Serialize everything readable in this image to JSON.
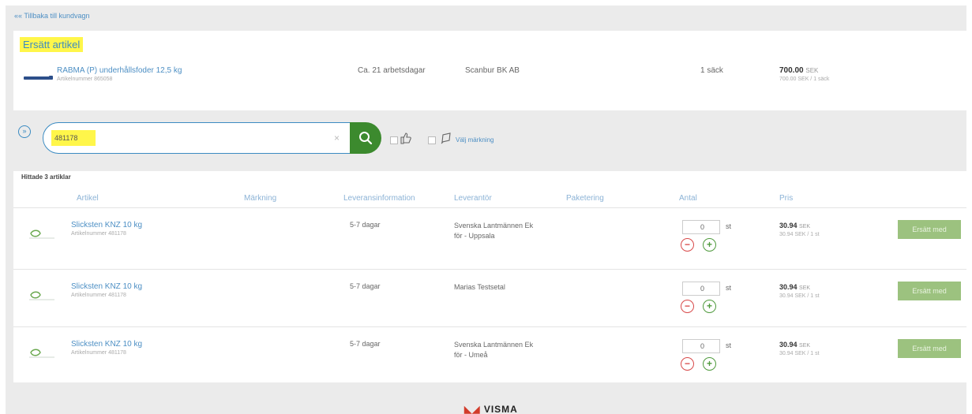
{
  "header": {
    "back_link": "«« Tillbaka till kundvagn"
  },
  "replace_section": {
    "title": "Ersätt artikel",
    "item": {
      "name": "RABMA (P) underhållsfoder 12,5 kg",
      "artnr": "Artikelnummer 865058",
      "lead_time": "Ca. 21 arbetsdagar",
      "supplier": "Scanbur BK AB",
      "packaging": "1 säck",
      "price": "700.00",
      "currency": "SEK",
      "price_unit": "700.00 SEK / 1 säck"
    }
  },
  "search": {
    "value": "481178",
    "clear": "×",
    "filter_label": "Välj märkning"
  },
  "results": {
    "count_label": "Hittade 3 artiklar",
    "columns": [
      "Artikel",
      "Märkning",
      "Leveransinformation",
      "Leverantör",
      "Paketering",
      "Antal",
      "Pris"
    ],
    "rows": [
      {
        "name": "Slicksten KNZ 10 kg",
        "artnr": "Artikelnummer 481178",
        "lead_time": "5-7 dagar",
        "supplier_line1": "Svenska Lantmännen Ek",
        "supplier_line2": "för - Uppsala",
        "qty": "0",
        "unit": "st",
        "price": "30.94",
        "currency": "SEK",
        "price_unit": "30.94 SEK / 1 st",
        "button": "Ersätt med"
      },
      {
        "name": "Slicksten KNZ 10 kg",
        "artnr": "Artikelnummer 481178",
        "lead_time": "5-7 dagar",
        "supplier_line1": "Marias Testsetal",
        "supplier_line2": "",
        "qty": "0",
        "unit": "st",
        "price": "30.94",
        "currency": "SEK",
        "price_unit": "30.94 SEK / 1 st",
        "button": "Ersätt med"
      },
      {
        "name": "Slicksten KNZ 10 kg",
        "artnr": "Artikelnummer 481178",
        "lead_time": "5-7 dagar",
        "supplier_line1": "Svenska Lantmännen Ek",
        "supplier_line2": "för - Umeå",
        "qty": "0",
        "unit": "st",
        "price": "30.94",
        "currency": "SEK",
        "price_unit": "30.94 SEK / 1 st",
        "button": "Ersätt med"
      }
    ]
  },
  "footer": {
    "logo_text": "VISMA"
  },
  "colors": {
    "accent_blue": "#3b8bc2",
    "search_green": "#3c8a2e",
    "replace_button_green": "#9cc27f",
    "highlight_yellow": "#fff64a",
    "minus_red": "#d84a4a",
    "plus_green": "#4f9a3d"
  }
}
